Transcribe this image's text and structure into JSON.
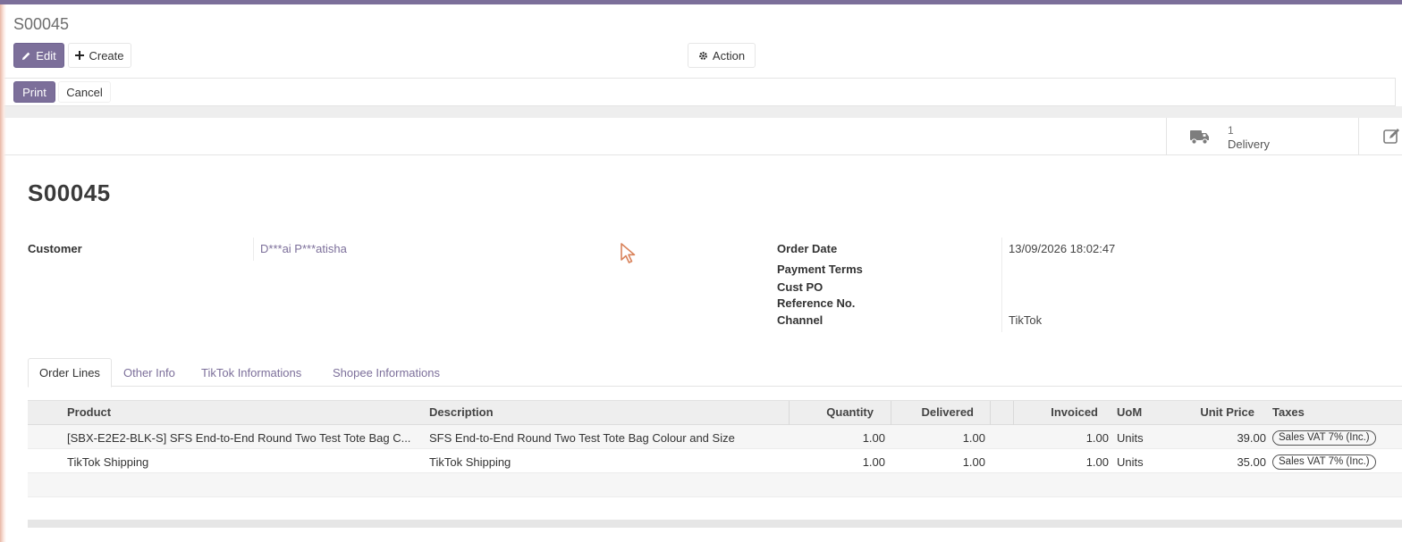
{
  "breadcrumb": "S00045",
  "toolbar": {
    "edit_label": "Edit",
    "create_label": "Create",
    "action_label": "Action"
  },
  "statusbar": {
    "print_label": "Print",
    "cancel_label": "Cancel"
  },
  "smart_button": {
    "count": "1",
    "label": "Delivery",
    "icon": "truck-icon"
  },
  "record": {
    "title": "S00045",
    "customer_label": "Customer",
    "customer_value": "D***ai P***atisha",
    "order_date_label": "Order Date",
    "order_date_value": "13/09/2026 18:02:47",
    "payment_terms_label": "Payment Terms",
    "cust_po_label": "Cust PO",
    "reference_label": "Reference No.",
    "channel_label": "Channel",
    "channel_value": "TikTok"
  },
  "tabs": [
    {
      "label": "Order Lines",
      "active": true
    },
    {
      "label": "Other Info",
      "active": false
    },
    {
      "label": "TikTok Informations",
      "active": false
    },
    {
      "label": "Shopee Informations",
      "active": false
    }
  ],
  "table": {
    "headers": {
      "product": "Product",
      "description": "Description",
      "quantity": "Quantity",
      "delivered": "Delivered",
      "invoiced": "Invoiced",
      "uom": "UoM",
      "unit_price": "Unit Price",
      "taxes": "Taxes"
    },
    "rows": [
      {
        "product": "[SBX-E2E2-BLK-S] SFS End-to-End Round Two Test Tote Bag C...",
        "description": "SFS End-to-End Round Two Test Tote Bag Colour and Size",
        "quantity": "1.00",
        "delivered": "1.00",
        "invoiced": "1.00",
        "uom": "Units",
        "unit_price": "39.00",
        "taxes": "Sales VAT 7% (Inc.)"
      },
      {
        "product": "TikTok Shipping",
        "description": "TikTok Shipping",
        "quantity": "1.00",
        "delivered": "1.00",
        "invoiced": "1.00",
        "uom": "Units",
        "unit_price": "35.00",
        "taxes": "Sales VAT 7% (Inc.)"
      }
    ]
  },
  "colors": {
    "brand": "#7c6f9a",
    "header_bg": "#eeeeee"
  }
}
